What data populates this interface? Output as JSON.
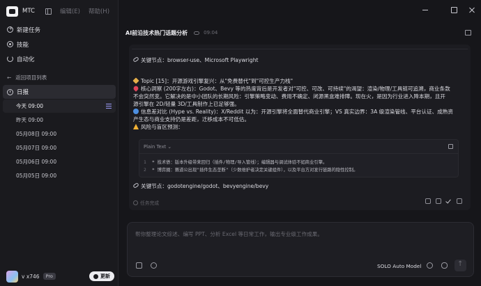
{
  "app": {
    "name": "MTC",
    "menu": [
      "编辑(E)",
      "帮助(H)"
    ]
  },
  "sidebar": {
    "nav": [
      {
        "label": "新建任务",
        "icon": "new-task-icon"
      },
      {
        "label": "技能",
        "icon": "skill-icon"
      },
      {
        "label": "自动化",
        "icon": "automation-icon"
      }
    ],
    "back_label": "返回项目列表",
    "project": "日报",
    "tasks": [
      "今天 09:00",
      "昨天 09:00",
      "05月08日 09:00",
      "05月07日 09:00",
      "05月06日 09:00",
      "05月05日 09:00"
    ],
    "user": {
      "name": "v x746",
      "badge": "Pro"
    },
    "update_label": "更新"
  },
  "header": {
    "title": "AI前沿技术热门话题分析",
    "time": "09:04"
  },
  "message": {
    "key_nodes_1": "关键节点：browser-use、Microsoft Playwright",
    "topic": "Topic [15]：开源游戏引擎复兴：从\"免费替代\"到\"可控生产力栈\"",
    "insight_1": "核心洞察 (200字左右)：Godot、Bevy 等的热度背后是开发者对\"可控、可改、可持续\"的渴望：渲染/物理/工具链可追溯，商业条款",
    "insight_2": "不会突然变。它解决的是中小团队的长期风险：引擎策略变动、费用不确定、闭源黑盒难排障。现在火，是因为行业进入降本期，且开",
    "insight_3": "源引擎在 2D/轻量 3D/工具制作上已足够强。",
    "contrast_1": "信息差对比 (Hype vs. Reality)：X/Reddit 以为：开源引擎将全面替代商业引擎；VS 真实边界：3A 级渲染管线、平台认证、成熟资",
    "contrast_2": "产生态与商业支持仍是差距，迁移成本不可低估。",
    "risk_title": "风险与盲区预测：",
    "code": {
      "lang": "Plain Text",
      "lines": [
        {
          "no": "1",
          "text": "* 技术债：版本升级带来回归（插件/物理/导入管线）；编辑器与调试体验不如商业引擎。"
        },
        {
          "no": "2",
          "text": "* 博弈圈：赛道公出现\"插件生态垄断\"（少数维护者决定关键组件），以及平台方对发行链路的隐性控制。"
        }
      ]
    },
    "key_nodes_2": "关键节点：godotengine/godot、bevyengine/bevy",
    "status": "任务完成"
  },
  "input": {
    "placeholder": "帮你整理论文综述、编写 PPT、分析 Excel 等日常工作，输出专业级工作成果。",
    "model": "SOLO Auto Model"
  },
  "colors": {
    "accent": "#9f9fff",
    "background": "#16161a",
    "sidebar": "#1a1a1e"
  }
}
